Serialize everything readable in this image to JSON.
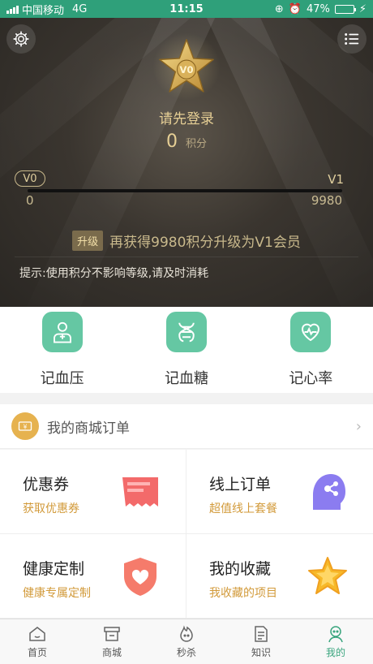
{
  "status": {
    "carrier": "中国移动",
    "network": "4G",
    "time": "11:15",
    "battery": "47%",
    "battery_level": 0.47
  },
  "hero": {
    "login_prompt": "请先登录",
    "points_value": "0",
    "points_unit": "积分",
    "level_current": "V0",
    "level_next": "V1",
    "progress_min": "0",
    "progress_max": "9980",
    "progress_fraction": 0.0,
    "upgrade_tag": "升级",
    "upgrade_text": "再获得9980积分升级为V1会员",
    "tip": "提示:使用积分不影响等级,请及时消耗"
  },
  "quick": [
    {
      "label": "记血压",
      "icon": "doctor-icon"
    },
    {
      "label": "记血糖",
      "icon": "dna-icon"
    },
    {
      "label": "记心率",
      "icon": "heart-rate-icon"
    }
  ],
  "orders": {
    "title": "我的商城订单",
    "icon": "ticket-icon"
  },
  "grid": [
    {
      "title": "优惠券",
      "sub": "获取优惠券",
      "icon": "coupon-icon"
    },
    {
      "title": "线上订单",
      "sub": "超值线上套餐",
      "icon": "online-order-icon"
    },
    {
      "title": "健康定制",
      "sub": "健康专属定制",
      "icon": "shield-heart-icon"
    },
    {
      "title": "我的收藏",
      "sub": "我收藏的项目",
      "icon": "star-icon"
    }
  ],
  "tabs": [
    {
      "label": "首页",
      "icon": "home-icon"
    },
    {
      "label": "商城",
      "icon": "shop-icon"
    },
    {
      "label": "秒杀",
      "icon": "flame-icon"
    },
    {
      "label": "知识",
      "icon": "document-icon"
    },
    {
      "label": "我的",
      "icon": "profile-icon"
    }
  ],
  "colors": {
    "status_bg": "#2fa07a",
    "accent_green": "#65c7a3",
    "gold": "#e6cf95",
    "active_tab": "#3aa57e"
  }
}
